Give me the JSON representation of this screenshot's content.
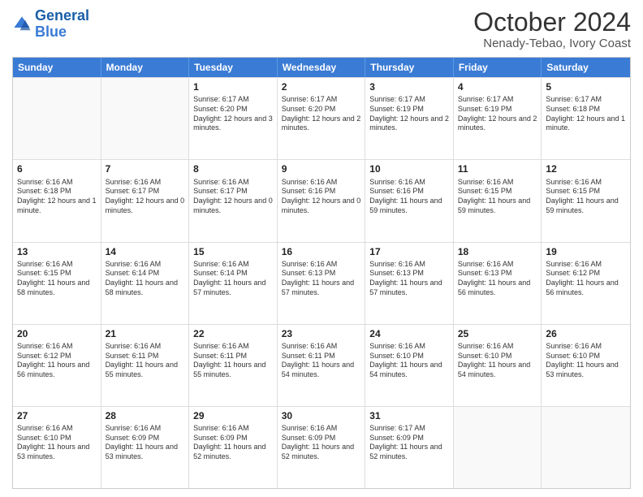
{
  "logo": {
    "line1": "General",
    "line2": "Blue"
  },
  "title": "October 2024",
  "location": "Nenady-Tebao, Ivory Coast",
  "days_of_week": [
    "Sunday",
    "Monday",
    "Tuesday",
    "Wednesday",
    "Thursday",
    "Friday",
    "Saturday"
  ],
  "weeks": [
    [
      {
        "day": "",
        "sunrise": "",
        "sunset": "",
        "daylight": ""
      },
      {
        "day": "",
        "sunrise": "",
        "sunset": "",
        "daylight": ""
      },
      {
        "day": "1",
        "sunrise": "Sunrise: 6:17 AM",
        "sunset": "Sunset: 6:20 PM",
        "daylight": "Daylight: 12 hours and 3 minutes."
      },
      {
        "day": "2",
        "sunrise": "Sunrise: 6:17 AM",
        "sunset": "Sunset: 6:20 PM",
        "daylight": "Daylight: 12 hours and 2 minutes."
      },
      {
        "day": "3",
        "sunrise": "Sunrise: 6:17 AM",
        "sunset": "Sunset: 6:19 PM",
        "daylight": "Daylight: 12 hours and 2 minutes."
      },
      {
        "day": "4",
        "sunrise": "Sunrise: 6:17 AM",
        "sunset": "Sunset: 6:19 PM",
        "daylight": "Daylight: 12 hours and 2 minutes."
      },
      {
        "day": "5",
        "sunrise": "Sunrise: 6:17 AM",
        "sunset": "Sunset: 6:18 PM",
        "daylight": "Daylight: 12 hours and 1 minute."
      }
    ],
    [
      {
        "day": "6",
        "sunrise": "Sunrise: 6:16 AM",
        "sunset": "Sunset: 6:18 PM",
        "daylight": "Daylight: 12 hours and 1 minute."
      },
      {
        "day": "7",
        "sunrise": "Sunrise: 6:16 AM",
        "sunset": "Sunset: 6:17 PM",
        "daylight": "Daylight: 12 hours and 0 minutes."
      },
      {
        "day": "8",
        "sunrise": "Sunrise: 6:16 AM",
        "sunset": "Sunset: 6:17 PM",
        "daylight": "Daylight: 12 hours and 0 minutes."
      },
      {
        "day": "9",
        "sunrise": "Sunrise: 6:16 AM",
        "sunset": "Sunset: 6:16 PM",
        "daylight": "Daylight: 12 hours and 0 minutes."
      },
      {
        "day": "10",
        "sunrise": "Sunrise: 6:16 AM",
        "sunset": "Sunset: 6:16 PM",
        "daylight": "Daylight: 11 hours and 59 minutes."
      },
      {
        "day": "11",
        "sunrise": "Sunrise: 6:16 AM",
        "sunset": "Sunset: 6:15 PM",
        "daylight": "Daylight: 11 hours and 59 minutes."
      },
      {
        "day": "12",
        "sunrise": "Sunrise: 6:16 AM",
        "sunset": "Sunset: 6:15 PM",
        "daylight": "Daylight: 11 hours and 59 minutes."
      }
    ],
    [
      {
        "day": "13",
        "sunrise": "Sunrise: 6:16 AM",
        "sunset": "Sunset: 6:15 PM",
        "daylight": "Daylight: 11 hours and 58 minutes."
      },
      {
        "day": "14",
        "sunrise": "Sunrise: 6:16 AM",
        "sunset": "Sunset: 6:14 PM",
        "daylight": "Daylight: 11 hours and 58 minutes."
      },
      {
        "day": "15",
        "sunrise": "Sunrise: 6:16 AM",
        "sunset": "Sunset: 6:14 PM",
        "daylight": "Daylight: 11 hours and 57 minutes."
      },
      {
        "day": "16",
        "sunrise": "Sunrise: 6:16 AM",
        "sunset": "Sunset: 6:13 PM",
        "daylight": "Daylight: 11 hours and 57 minutes."
      },
      {
        "day": "17",
        "sunrise": "Sunrise: 6:16 AM",
        "sunset": "Sunset: 6:13 PM",
        "daylight": "Daylight: 11 hours and 57 minutes."
      },
      {
        "day": "18",
        "sunrise": "Sunrise: 6:16 AM",
        "sunset": "Sunset: 6:13 PM",
        "daylight": "Daylight: 11 hours and 56 minutes."
      },
      {
        "day": "19",
        "sunrise": "Sunrise: 6:16 AM",
        "sunset": "Sunset: 6:12 PM",
        "daylight": "Daylight: 11 hours and 56 minutes."
      }
    ],
    [
      {
        "day": "20",
        "sunrise": "Sunrise: 6:16 AM",
        "sunset": "Sunset: 6:12 PM",
        "daylight": "Daylight: 11 hours and 56 minutes."
      },
      {
        "day": "21",
        "sunrise": "Sunrise: 6:16 AM",
        "sunset": "Sunset: 6:11 PM",
        "daylight": "Daylight: 11 hours and 55 minutes."
      },
      {
        "day": "22",
        "sunrise": "Sunrise: 6:16 AM",
        "sunset": "Sunset: 6:11 PM",
        "daylight": "Daylight: 11 hours and 55 minutes."
      },
      {
        "day": "23",
        "sunrise": "Sunrise: 6:16 AM",
        "sunset": "Sunset: 6:11 PM",
        "daylight": "Daylight: 11 hours and 54 minutes."
      },
      {
        "day": "24",
        "sunrise": "Sunrise: 6:16 AM",
        "sunset": "Sunset: 6:10 PM",
        "daylight": "Daylight: 11 hours and 54 minutes."
      },
      {
        "day": "25",
        "sunrise": "Sunrise: 6:16 AM",
        "sunset": "Sunset: 6:10 PM",
        "daylight": "Daylight: 11 hours and 54 minutes."
      },
      {
        "day": "26",
        "sunrise": "Sunrise: 6:16 AM",
        "sunset": "Sunset: 6:10 PM",
        "daylight": "Daylight: 11 hours and 53 minutes."
      }
    ],
    [
      {
        "day": "27",
        "sunrise": "Sunrise: 6:16 AM",
        "sunset": "Sunset: 6:10 PM",
        "daylight": "Daylight: 11 hours and 53 minutes."
      },
      {
        "day": "28",
        "sunrise": "Sunrise: 6:16 AM",
        "sunset": "Sunset: 6:09 PM",
        "daylight": "Daylight: 11 hours and 53 minutes."
      },
      {
        "day": "29",
        "sunrise": "Sunrise: 6:16 AM",
        "sunset": "Sunset: 6:09 PM",
        "daylight": "Daylight: 11 hours and 52 minutes."
      },
      {
        "day": "30",
        "sunrise": "Sunrise: 6:16 AM",
        "sunset": "Sunset: 6:09 PM",
        "daylight": "Daylight: 11 hours and 52 minutes."
      },
      {
        "day": "31",
        "sunrise": "Sunrise: 6:17 AM",
        "sunset": "Sunset: 6:09 PM",
        "daylight": "Daylight: 11 hours and 52 minutes."
      },
      {
        "day": "",
        "sunrise": "",
        "sunset": "",
        "daylight": ""
      },
      {
        "day": "",
        "sunrise": "",
        "sunset": "",
        "daylight": ""
      }
    ]
  ]
}
